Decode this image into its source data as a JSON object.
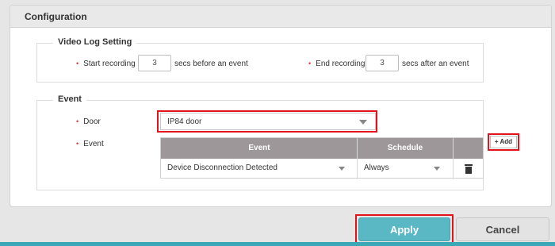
{
  "panel": {
    "title": "Configuration"
  },
  "video_log": {
    "legend": "Video Log Setting",
    "start_label": "Start recording",
    "start_value": "3",
    "start_suffix": "secs before an event",
    "end_label": "End recording",
    "end_value": "3",
    "end_suffix": "secs after an event"
  },
  "event_section": {
    "legend": "Event",
    "door_label": "Door",
    "door_value": "IP84 door",
    "event_label": "Event",
    "add_label": "+ Add",
    "table": {
      "headers": [
        "Event",
        "Schedule"
      ],
      "rows": [
        {
          "event": "Device Disconnection Detected",
          "schedule": "Always"
        }
      ]
    }
  },
  "footer": {
    "apply_label": "Apply",
    "cancel_label": "Cancel"
  },
  "colors": {
    "accent": "#5ab8c4",
    "highlight": "#e3131b",
    "bullet": "#e0342f",
    "table_header": "#9e979a"
  }
}
